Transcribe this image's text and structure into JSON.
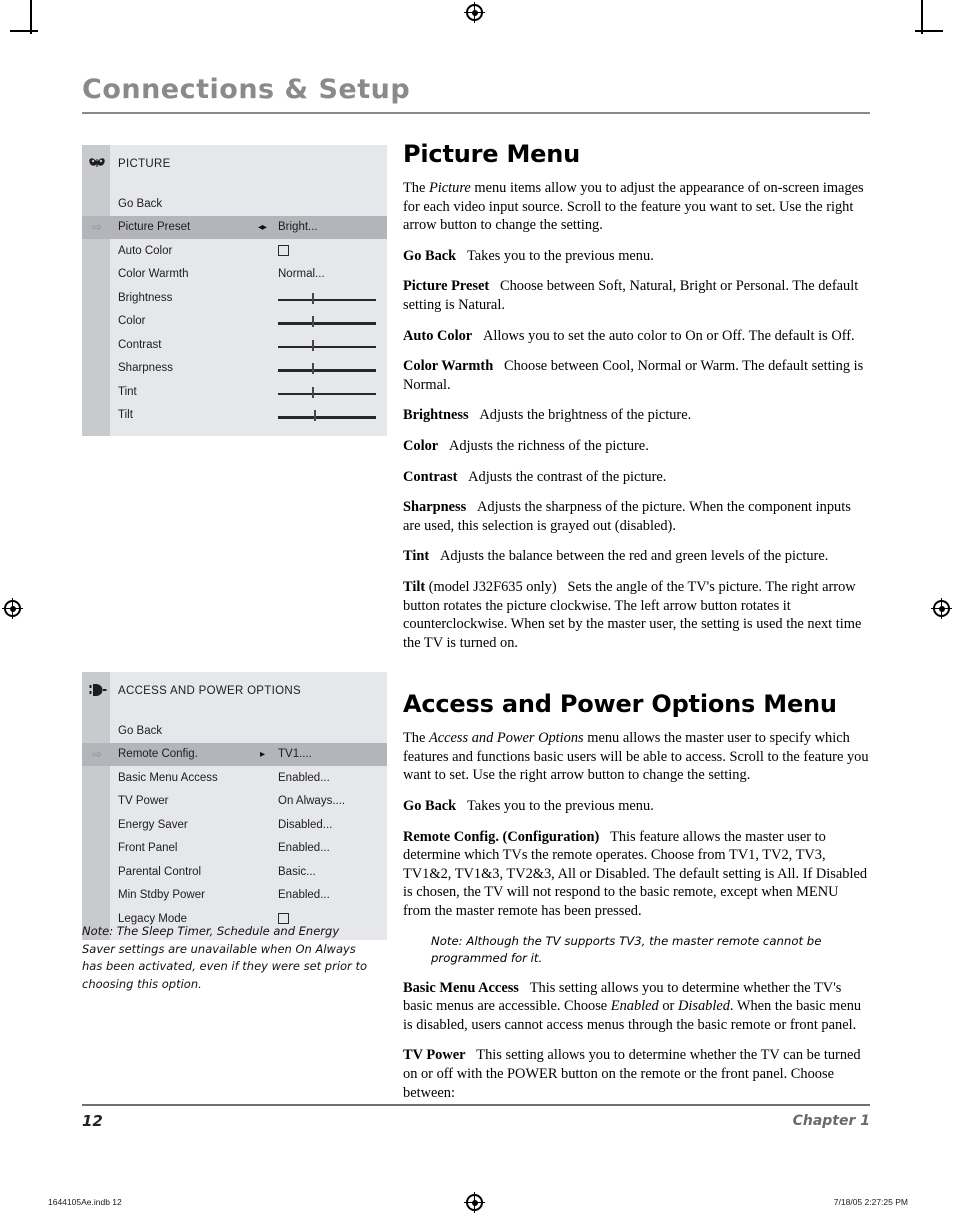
{
  "header": {
    "title": "Connections & Setup"
  },
  "picture_menu_osd": {
    "icon": "picture-butterfly-icon",
    "title": "PICTURE",
    "rows": [
      {
        "label": "Go Back",
        "type": "plain",
        "value": "",
        "selected": false
      },
      {
        "label": "Picture Preset",
        "type": "value",
        "value": "Bright...",
        "selected": true,
        "arrows": "◂▸"
      },
      {
        "label": "Auto Color",
        "type": "checkbox",
        "value": "",
        "selected": false
      },
      {
        "label": "Color Warmth",
        "type": "value",
        "value": "Normal...",
        "selected": false
      },
      {
        "label": "Brightness",
        "type": "slider",
        "value": 35,
        "selected": false
      },
      {
        "label": "Color",
        "type": "slider",
        "value": 35,
        "selected": false
      },
      {
        "label": "Contrast",
        "type": "slider",
        "value": 35,
        "selected": false
      },
      {
        "label": "Sharpness",
        "type": "slider",
        "value": 35,
        "selected": false
      },
      {
        "label": "Tint",
        "type": "slider",
        "value": 35,
        "selected": false
      },
      {
        "label": "Tilt",
        "type": "slider",
        "value": 37,
        "selected": false
      }
    ]
  },
  "access_menu_osd": {
    "icon": "power-plug-icon",
    "title": "ACCESS AND POWER OPTIONS",
    "rows": [
      {
        "label": "Go Back",
        "type": "plain",
        "value": "",
        "selected": false
      },
      {
        "label": "Remote Config.",
        "type": "value",
        "value": "TV1....",
        "selected": true,
        "arrows": "▸"
      },
      {
        "label": "Basic Menu Access",
        "type": "value",
        "value": "Enabled...",
        "selected": false
      },
      {
        "label": "TV Power",
        "type": "value",
        "value": "On Always....",
        "selected": false
      },
      {
        "label": "Energy Saver",
        "type": "value",
        "value": "Disabled...",
        "selected": false
      },
      {
        "label": "Front Panel",
        "type": "value",
        "value": "Enabled...",
        "selected": false
      },
      {
        "label": "Parental Control",
        "type": "value",
        "value": "Basic...",
        "selected": false
      },
      {
        "label": "Min Stdby Power",
        "type": "value",
        "value": "Enabled...",
        "selected": false
      },
      {
        "label": "Legacy Mode",
        "type": "checkbox",
        "value": "",
        "selected": false
      }
    ]
  },
  "side_note": "Note: The Sleep Timer, Schedule and Energy Saver settings are unavailable when On Always has been activated, even if they were set prior to choosing this option.",
  "picture_section": {
    "heading": "Picture Menu",
    "intro_a": "The ",
    "intro_em": "Picture",
    "intro_b": " menu items allow you to adjust the appearance of on-screen images for each video input source. Scroll to the feature you want to set. Use the right arrow button to change the setting.",
    "items": [
      {
        "term": "Go Back",
        "desc": "Takes you to the previous menu."
      },
      {
        "term": "Picture Preset",
        "desc": "Choose between Soft, Natural, Bright or Personal. The default setting is Natural."
      },
      {
        "term": "Auto Color",
        "desc": "Allows you to set the auto color to On or Off. The default is Off."
      },
      {
        "term": "Color Warmth",
        "desc": "Choose between Cool, Normal or Warm. The default setting is Normal."
      },
      {
        "term": "Brightness",
        "desc": "Adjusts the brightness of the picture."
      },
      {
        "term": "Color",
        "desc": "Adjusts the richness of the picture."
      },
      {
        "term": "Contrast",
        "desc": "Adjusts the contrast of the picture."
      },
      {
        "term": "Sharpness",
        "desc": "Adjusts the sharpness of the picture. When the component inputs are used, this selection is grayed out (disabled)."
      },
      {
        "term": "Tint",
        "desc": "Adjusts the balance between the red and green levels of the picture."
      }
    ],
    "tilt_term": "Tilt",
    "tilt_model": " (model J32F635 only)",
    "tilt_desc": "Sets the angle of the TV's picture. The right arrow button rotates the picture clockwise. The left arrow button rotates it counterclockwise. When set by the master user, the setting is used the next time the TV is turned on."
  },
  "access_section": {
    "heading": "Access and Power Options Menu",
    "intro_a": "The ",
    "intro_em": "Access and Power Options",
    "intro_b": " menu allows the master user to specify which features and functions basic users will be able to access. Scroll to the feature you want to set. Use the right arrow button to change the setting.",
    "go_back_term": "Go Back",
    "go_back_desc": "Takes you to the previous menu.",
    "remote_term_a": "Remote Config",
    "remote_term_b": ". (Configuration)",
    "remote_desc": "This feature allows the master user to determine which TVs the remote operates. Choose from TV1, TV2, TV3, TV1&2, TV1&3, TV2&3, All or Disabled. The default setting is All. If Disabled is chosen, the TV will not respond to the basic remote, except when MENU from the master remote has been pressed.",
    "inset_note": "Note: Although the TV supports TV3, the master remote cannot be programmed for it.",
    "basic_term": "Basic Menu Access",
    "basic_desc_a": "This setting allows you to determine whether the TV's basic menus are accessible. Choose ",
    "basic_em1": "Enabled",
    "basic_desc_b": " or ",
    "basic_em2": "Disabled",
    "basic_desc_c": ". When the basic menu is disabled, users cannot access menus through the basic remote or front panel.",
    "tvpower_term": "TV Power",
    "tvpower_desc": "This setting allows you to determine whether the TV can be turned on or off with the POWER button on the remote or the front panel. Choose between:"
  },
  "footer": {
    "page_number": "12",
    "chapter": "Chapter 1"
  },
  "print_slug": {
    "left": "1644105Ae.indb   12",
    "right": "7/18/05   2:27:25 PM"
  }
}
